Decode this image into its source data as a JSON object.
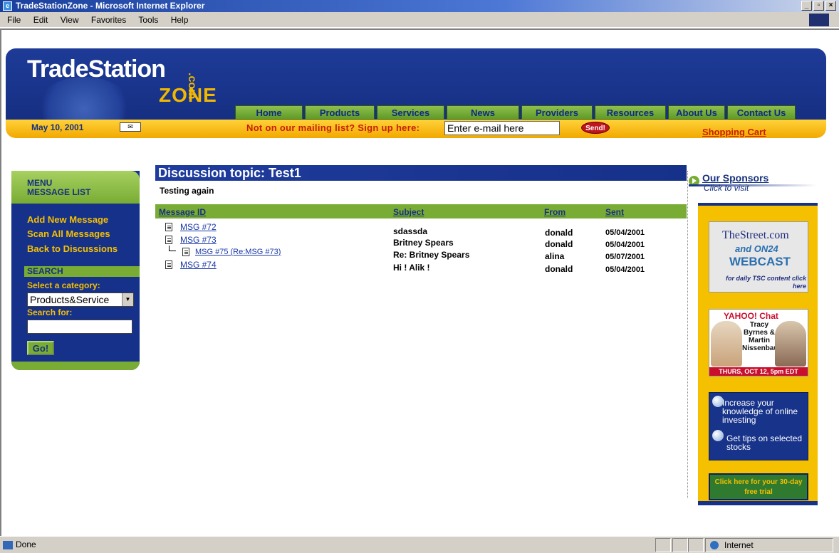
{
  "window": {
    "title": "TradeStationZone - Microsoft Internet Explorer",
    "menu": [
      "File",
      "Edit",
      "View",
      "Favorites",
      "Tools",
      "Help"
    ],
    "status": "Done",
    "zone": "Internet"
  },
  "header": {
    "logo_main": "TradeStation",
    "logo_sub": "ZONE",
    "logo_com": ".com",
    "date": "May 10, 2001",
    "nav": [
      "Home",
      "Products",
      "Services",
      "News",
      "Providers",
      "Resources",
      "About Us",
      "Contact Us"
    ],
    "mailing_prompt": "Not on our mailing list? Sign up here:",
    "email_placeholder": "Enter e-mail here",
    "send_label": "Send!",
    "cart_label": "Shopping Cart"
  },
  "sidebar": {
    "menu_title": "MENU",
    "menu_subtitle": "MESSAGE LIST",
    "links": [
      "Add New Message",
      "Scan All Messages",
      "Back to Discussions"
    ],
    "search_title": "SEARCH",
    "category_label": "Select a category:",
    "category_value": "Products&Service",
    "search_label": "Search for:",
    "search_value": "",
    "go_label": "Go!"
  },
  "main": {
    "topic_title": "Discussion topic: Test1",
    "topic_desc": "Testing again",
    "columns": [
      "Message ID",
      "Subject",
      "From",
      "Sent"
    ],
    "messages": [
      {
        "id": "MSG #72",
        "subject": "sdassda",
        "from": "donald",
        "sent": "05/04/2001"
      },
      {
        "id": "MSG #73",
        "subject": "Britney Spears",
        "from": "donald",
        "sent": "05/04/2001"
      },
      {
        "id": "MSG #75 (Re:MSG #73)",
        "subject": "Re: Britney Spears",
        "from": "alina",
        "sent": "05/07/2001"
      },
      {
        "id": "MSG #74",
        "subject": "Hi ! Alik !",
        "from": "donald",
        "sent": "05/04/2001"
      }
    ]
  },
  "sponsors": {
    "title": "Our Sponsors",
    "subtitle": "Click to visit",
    "ad1": {
      "brand": "TheStreet.com",
      "and": "and",
      "partner": "ON24",
      "webcast": "WEBCAST",
      "tagline": "for daily TSC content click here"
    },
    "ad2": {
      "brand": "YAHOO! Chat",
      "names": "Tracy Byrnes & Martin Nissenbaum",
      "date": "THURS, OCT 12, 5pm EDT"
    },
    "ad3": {
      "line1": "Increase your knowledge of online investing",
      "line2": "Get tips on selected stocks"
    },
    "ad4": {
      "text": "Click here for your 30-day free trial"
    }
  }
}
